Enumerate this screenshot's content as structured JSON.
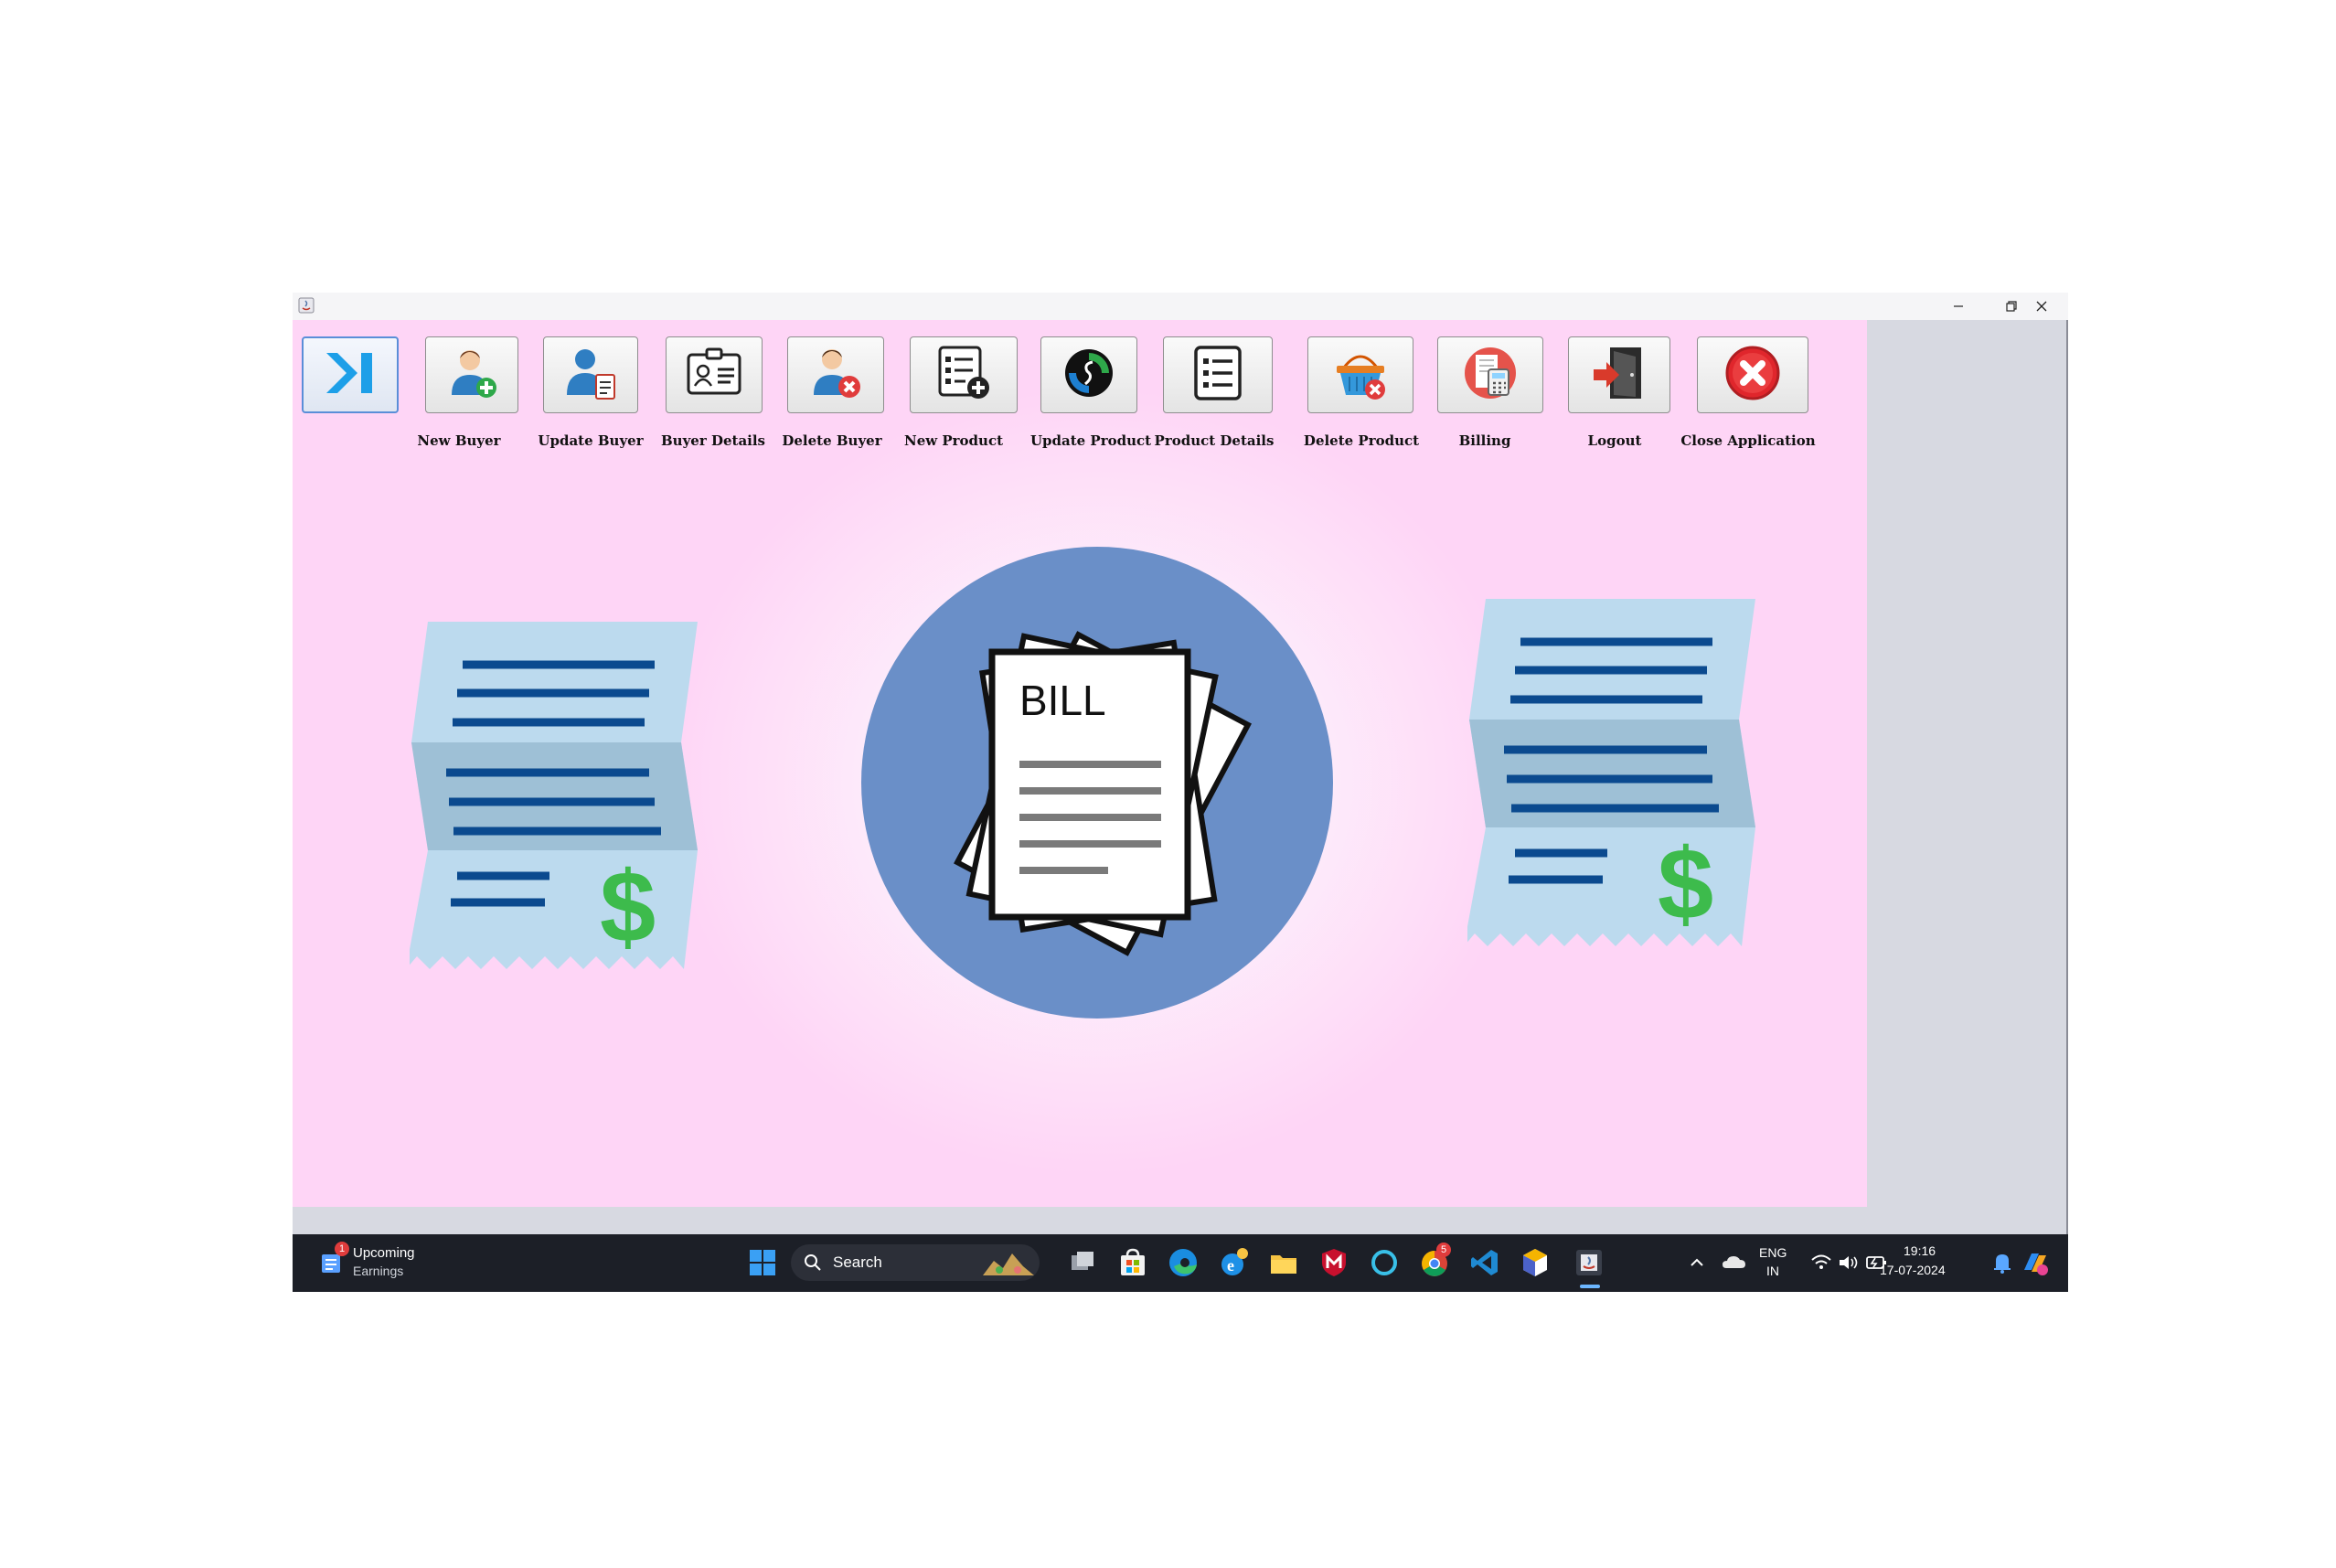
{
  "toolbar": {
    "items": [
      {
        "label": "",
        "icon": "menu-arrow-icon"
      },
      {
        "label": "New Buyer",
        "icon": "add-user-icon"
      },
      {
        "label": "Update Buyer",
        "icon": "edit-user-icon"
      },
      {
        "label": "Buyer Details",
        "icon": "id-card-icon"
      },
      {
        "label": "Delete Buyer",
        "icon": "remove-user-icon"
      },
      {
        "label": "New Product",
        "icon": "add-list-icon"
      },
      {
        "label": "Update Product",
        "icon": "refresh-icon"
      },
      {
        "label": "Product Details",
        "icon": "list-icon"
      },
      {
        "label": "Delete Product",
        "icon": "basket-delete-icon"
      },
      {
        "label": "Billing",
        "icon": "calculator-icon"
      },
      {
        "label": "Logout",
        "icon": "logout-door-icon"
      },
      {
        "label": "Close Application",
        "icon": "close-circle-icon"
      }
    ]
  },
  "illustration": {
    "bill_text": "BILL",
    "currency_symbol": "$"
  },
  "taskbar": {
    "widget_badge": "1",
    "widget_title": "Upcoming",
    "widget_subtitle": "Earnings",
    "search_placeholder": "Search",
    "language_top": "ENG",
    "language_bottom": "IN",
    "time": "19:16",
    "date": "17-07-2024",
    "chrome_badge": "5"
  },
  "colors": {
    "client_bg": "#fed5f6",
    "right_pane": "#d7d9e1",
    "circle": "#6a8fc8",
    "receipt": "#bcdaee",
    "receipt_lines": "#0b4a8f",
    "dollar": "#3dbb4c",
    "taskbar": "#1c1f27"
  }
}
